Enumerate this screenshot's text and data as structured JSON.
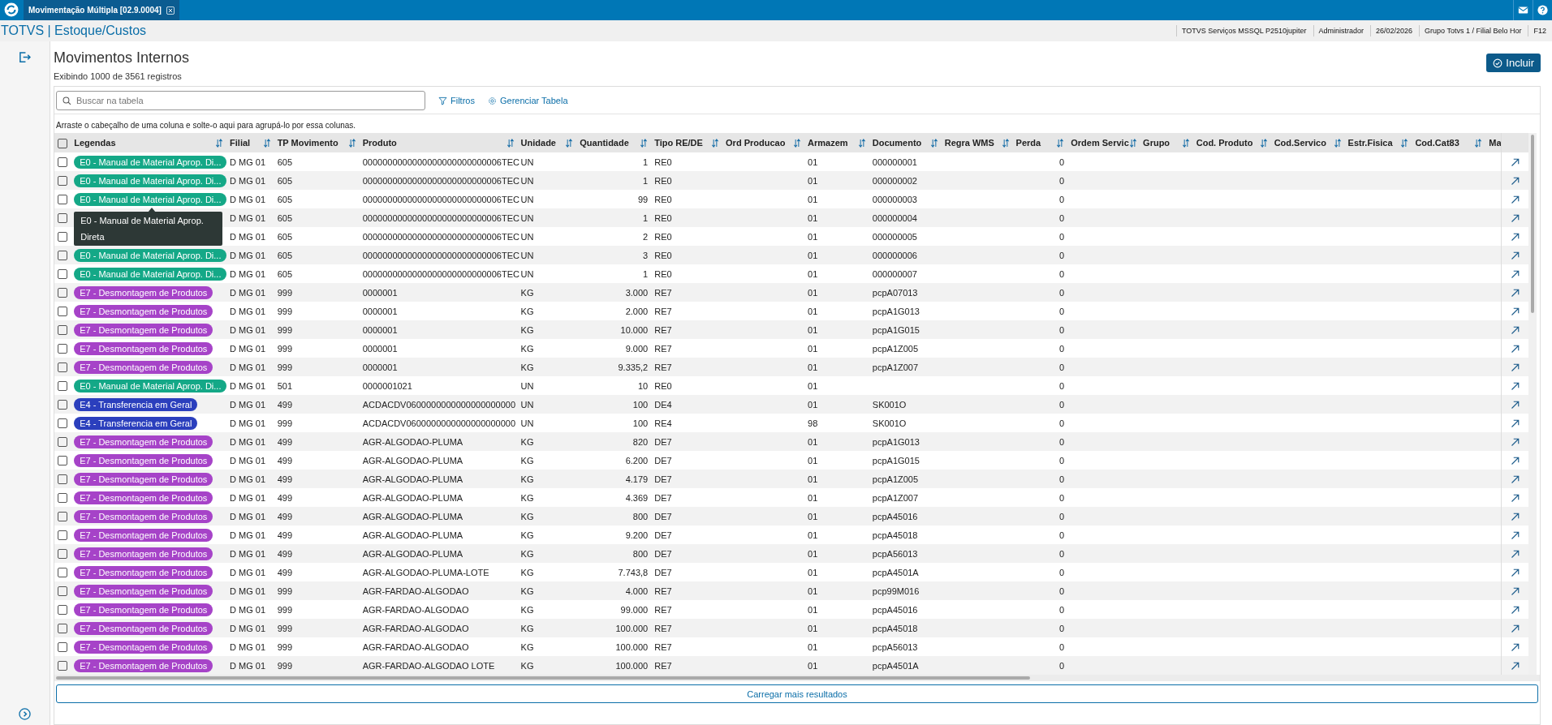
{
  "top_bar": {
    "tab": {
      "title": "Movimentação Múltipla [02.9.0004]",
      "selected": true
    }
  },
  "header": {
    "breadcrumb": "TOTVS | Estoque/Custos",
    "info": [
      "TOTVS Serviços MSSQL P2510jupiter",
      "Administrador",
      "26/02/2026",
      "Grupo Totvs 1 / Filial Belo Hor",
      "F12"
    ]
  },
  "page": {
    "title": "Movimentos Internos",
    "subtitle": "Exibindo 1000 de 3561 registros",
    "primary_action": "Incluir"
  },
  "toolbar": {
    "search_placeholder": "Buscar na tabela",
    "filters": "Filtros",
    "manage": "Gerenciar Tabela"
  },
  "group_hint": "Arraste o cabeçalho de uma coluna e solte-o aqui para agrupá-lo por essa colunas.",
  "table": {
    "all_selected": false,
    "columns": [
      {
        "label": "Legendas",
        "sort_icon": true
      },
      {
        "label": "Filial",
        "sort_icon": true
      },
      {
        "label": "TP Movimento",
        "sort_icon": true
      },
      {
        "label": "Produto",
        "sort_icon": true
      },
      {
        "label": "Unidade",
        "sort_icon": true
      },
      {
        "label": "Quantidade",
        "sort_icon": true
      },
      {
        "label": "Tipo RE/DE",
        "sort_icon": true
      },
      {
        "label": "Ord Producao",
        "sort_icon": true
      },
      {
        "label": "Armazem",
        "sort_icon": true
      },
      {
        "label": "Documento",
        "sort_icon": true
      },
      {
        "label": "Regra WMS",
        "sort_icon": true
      },
      {
        "label": "Perda",
        "sort_icon": true
      },
      {
        "label": "Ordem Servic",
        "sort_icon": true
      },
      {
        "label": "Grupo",
        "sort_icon": true
      },
      {
        "label": "Cod. Produto",
        "sort_icon": true
      },
      {
        "label": "Cod.Servico",
        "sort_icon": true
      },
      {
        "label": "Estr.Fisica",
        "sort_icon": true
      },
      {
        "label": "Cod.Cat83",
        "sort_icon": true
      },
      {
        "label": "Ma",
        "sort_icon": false
      }
    ],
    "rows": [
      {
        "selected": false,
        "color": "#14a887",
        "cells": [
          "E0 - Manual de Material Aprop. Di...",
          "D MG 01",
          "605",
          "0000000000000000000000000006TEC",
          "UN",
          "1",
          "RE0",
          "",
          "01",
          "000000001",
          "",
          "0"
        ]
      },
      {
        "selected": false,
        "color": "#14a887",
        "cells": [
          "E0 - Manual de Material Aprop. Di...",
          "D MG 01",
          "605",
          "0000000000000000000000000006TEC",
          "UN",
          "1",
          "RE0",
          "",
          "01",
          "000000002",
          "",
          "0"
        ]
      },
      {
        "selected": false,
        "color": "#14a887",
        "tooltip": "E0 - Manual de Material Aprop. Direta",
        "cells": [
          "E0 - Manual de Material Aprop. Di...",
          "D MG 01",
          "605",
          "0000000000000000000000000006TEC",
          "UN",
          "99",
          "RE0",
          "",
          "01",
          "000000003",
          "",
          "0"
        ]
      },
      {
        "selected": false,
        "cells": [
          "",
          "D MG 01",
          "605",
          "0000000000000000000000000006TEC",
          "UN",
          "1",
          "RE0",
          "",
          "01",
          "000000004",
          "",
          "0"
        ]
      },
      {
        "selected": false,
        "cells": [
          "",
          "D MG 01",
          "605",
          "0000000000000000000000000006TEC",
          "UN",
          "2",
          "RE0",
          "",
          "01",
          "000000005",
          "",
          "0"
        ]
      },
      {
        "selected": false,
        "color": "#14a887",
        "cells": [
          "E0 - Manual de Material Aprop. Di...",
          "D MG 01",
          "605",
          "0000000000000000000000000006TEC",
          "UN",
          "3",
          "RE0",
          "",
          "01",
          "000000006",
          "",
          "0"
        ]
      },
      {
        "selected": false,
        "color": "#14a887",
        "cells": [
          "E0 - Manual de Material Aprop. Di...",
          "D MG 01",
          "605",
          "0000000000000000000000000006TEC",
          "UN",
          "1",
          "RE0",
          "",
          "01",
          "000000007",
          "",
          "0"
        ]
      },
      {
        "selected": false,
        "color": "#a643c8",
        "cells": [
          "E7 - Desmontagem de Produtos",
          "D MG 01",
          "999",
          "0000001",
          "KG",
          "3.000",
          "RE7",
          "",
          "01",
          "pcpA07013",
          "",
          "0"
        ]
      },
      {
        "selected": false,
        "color": "#a643c8",
        "cells": [
          "E7 - Desmontagem de Produtos",
          "D MG 01",
          "999",
          "0000001",
          "KG",
          "2.000",
          "RE7",
          "",
          "01",
          "pcpA1G013",
          "",
          "0"
        ]
      },
      {
        "selected": false,
        "color": "#a643c8",
        "cells": [
          "E7 - Desmontagem de Produtos",
          "D MG 01",
          "999",
          "0000001",
          "KG",
          "10.000",
          "RE7",
          "",
          "01",
          "pcpA1G015",
          "",
          "0"
        ]
      },
      {
        "selected": false,
        "color": "#a643c8",
        "cells": [
          "E7 - Desmontagem de Produtos",
          "D MG 01",
          "999",
          "0000001",
          "KG",
          "9.000",
          "RE7",
          "",
          "01",
          "pcpA1Z005",
          "",
          "0"
        ]
      },
      {
        "selected": false,
        "color": "#a643c8",
        "cells": [
          "E7 - Desmontagem de Produtos",
          "D MG 01",
          "999",
          "0000001",
          "KG",
          "9.335,2",
          "RE7",
          "",
          "01",
          "pcpA1Z007",
          "",
          "0"
        ]
      },
      {
        "selected": false,
        "color": "#14a887",
        "cells": [
          "E0 - Manual de Material Aprop. Di...",
          "D MG 01",
          "501",
          "0000001021",
          "UN",
          "10",
          "RE0",
          "",
          "01",
          "",
          "",
          "0"
        ]
      },
      {
        "selected": false,
        "color": "#2b3fbd",
        "cells": [
          "E4 - Transferencia em Geral",
          "D MG 01",
          "499",
          "ACDACDV0600000000000000000000",
          "UN",
          "100",
          "DE4",
          "",
          "01",
          "SK001O",
          "",
          "0"
        ]
      },
      {
        "selected": false,
        "color": "#2b3fbd",
        "cells": [
          "E4 - Transferencia em Geral",
          "D MG 01",
          "999",
          "ACDACDV0600000000000000000000",
          "UN",
          "100",
          "RE4",
          "",
          "98",
          "SK001O",
          "",
          "0"
        ]
      },
      {
        "selected": false,
        "color": "#a643c8",
        "cells": [
          "E7 - Desmontagem de Produtos",
          "D MG 01",
          "499",
          "AGR-ALGODAO-PLUMA",
          "KG",
          "820",
          "DE7",
          "",
          "01",
          "pcpA1G013",
          "",
          "0"
        ]
      },
      {
        "selected": false,
        "color": "#a643c8",
        "cells": [
          "E7 - Desmontagem de Produtos",
          "D MG 01",
          "499",
          "AGR-ALGODAO-PLUMA",
          "KG",
          "6.200",
          "DE7",
          "",
          "01",
          "pcpA1G015",
          "",
          "0"
        ]
      },
      {
        "selected": false,
        "color": "#a643c8",
        "cells": [
          "E7 - Desmontagem de Produtos",
          "D MG 01",
          "499",
          "AGR-ALGODAO-PLUMA",
          "KG",
          "4.179",
          "DE7",
          "",
          "01",
          "pcpA1Z005",
          "",
          "0"
        ]
      },
      {
        "selected": false,
        "color": "#a643c8",
        "cells": [
          "E7 - Desmontagem de Produtos",
          "D MG 01",
          "499",
          "AGR-ALGODAO-PLUMA",
          "KG",
          "4.369",
          "DE7",
          "",
          "01",
          "pcpA1Z007",
          "",
          "0"
        ]
      },
      {
        "selected": false,
        "color": "#a643c8",
        "cells": [
          "E7 - Desmontagem de Produtos",
          "D MG 01",
          "499",
          "AGR-ALGODAO-PLUMA",
          "KG",
          "800",
          "DE7",
          "",
          "01",
          "pcpA45016",
          "",
          "0"
        ]
      },
      {
        "selected": false,
        "color": "#a643c8",
        "cells": [
          "E7 - Desmontagem de Produtos",
          "D MG 01",
          "499",
          "AGR-ALGODAO-PLUMA",
          "KG",
          "9.200",
          "DE7",
          "",
          "01",
          "pcpA45018",
          "",
          "0"
        ]
      },
      {
        "selected": false,
        "color": "#a643c8",
        "cells": [
          "E7 - Desmontagem de Produtos",
          "D MG 01",
          "499",
          "AGR-ALGODAO-PLUMA",
          "KG",
          "800",
          "DE7",
          "",
          "01",
          "pcpA56013",
          "",
          "0"
        ]
      },
      {
        "selected": false,
        "color": "#a643c8",
        "cells": [
          "E7 - Desmontagem de Produtos",
          "D MG 01",
          "499",
          "AGR-ALGODAO-PLUMA-LOTE",
          "KG",
          "7.743,8",
          "DE7",
          "",
          "01",
          "pcpA4501A",
          "",
          "0"
        ]
      },
      {
        "selected": false,
        "color": "#a643c8",
        "cells": [
          "E7 - Desmontagem de Produtos",
          "D MG 01",
          "999",
          "AGR-FARDAO-ALGODAO",
          "KG",
          "4.000",
          "RE7",
          "",
          "01",
          "pcp99M016",
          "",
          "0"
        ]
      },
      {
        "selected": false,
        "color": "#a643c8",
        "cells": [
          "E7 - Desmontagem de Produtos",
          "D MG 01",
          "999",
          "AGR-FARDAO-ALGODAO",
          "KG",
          "99.000",
          "RE7",
          "",
          "01",
          "pcpA45016",
          "",
          "0"
        ]
      },
      {
        "selected": false,
        "color": "#a643c8",
        "cells": [
          "E7 - Desmontagem de Produtos",
          "D MG 01",
          "999",
          "AGR-FARDAO-ALGODAO",
          "KG",
          "100.000",
          "RE7",
          "",
          "01",
          "pcpA45018",
          "",
          "0"
        ]
      },
      {
        "selected": false,
        "color": "#a643c8",
        "cells": [
          "E7 - Desmontagem de Produtos",
          "D MG 01",
          "999",
          "AGR-FARDAO-ALGODAO",
          "KG",
          "100.000",
          "RE7",
          "",
          "01",
          "pcpA56013",
          "",
          "0"
        ]
      },
      {
        "selected": false,
        "color": "#a643c8",
        "cells": [
          "E7 - Desmontagem de Produtos",
          "D MG 01",
          "999",
          "AGR-FARDAO-ALGODAO LOTE",
          "KG",
          "100.000",
          "RE7",
          "",
          "01",
          "pcpA4501A",
          "",
          "0"
        ]
      }
    ]
  },
  "load_more": "Carregar mais resultados"
}
